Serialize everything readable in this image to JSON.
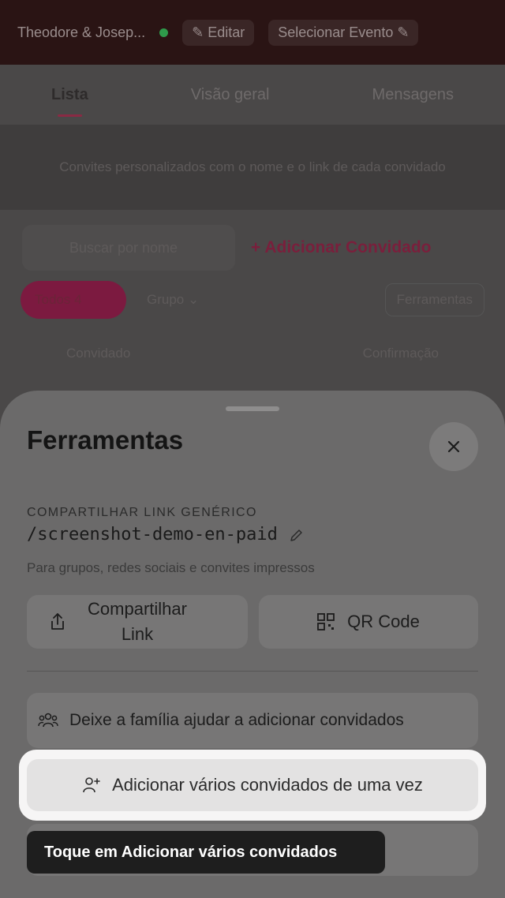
{
  "topbar": {
    "couple_name": "Theodore & Josep...",
    "edit_label": "Editar",
    "select_event_label": "Selecionar Evento"
  },
  "tabs": [
    "Lista",
    "Visão geral",
    "Mensagens"
  ],
  "banner_text": "Convites personalizados com o nome e o link de cada convidado",
  "search": {
    "placeholder": "Buscar por nome"
  },
  "add_guest_label": "Adicionar Convidado",
  "filters": {
    "all_chip": "Todos 4",
    "group_label": "Grupo",
    "tools_label": "Ferramentas"
  },
  "table": {
    "col_guest": "Convidado",
    "col_confirm": "Confirmação"
  },
  "sheet": {
    "title": "Ferramentas",
    "section_label": "COMPARTILHAR LINK GENÉRICO",
    "link_path": "/screenshot-demo-en-paid",
    "link_description": "Para grupos, redes sociais e convites impressos",
    "share_link_label": "Compartilhar Link",
    "qr_code_label": "QR Code",
    "family_help_label": "Deixe a família ajudar a adicionar convidados",
    "add_multiple_label": "Adicionar vários convidados de uma vez"
  },
  "tooltip": "Toque em Adicionar vários convidados",
  "colors": {
    "accent": "#d6336c",
    "sheet_bg": "#ffffff",
    "tooltip_bg": "#1e1e1e"
  }
}
